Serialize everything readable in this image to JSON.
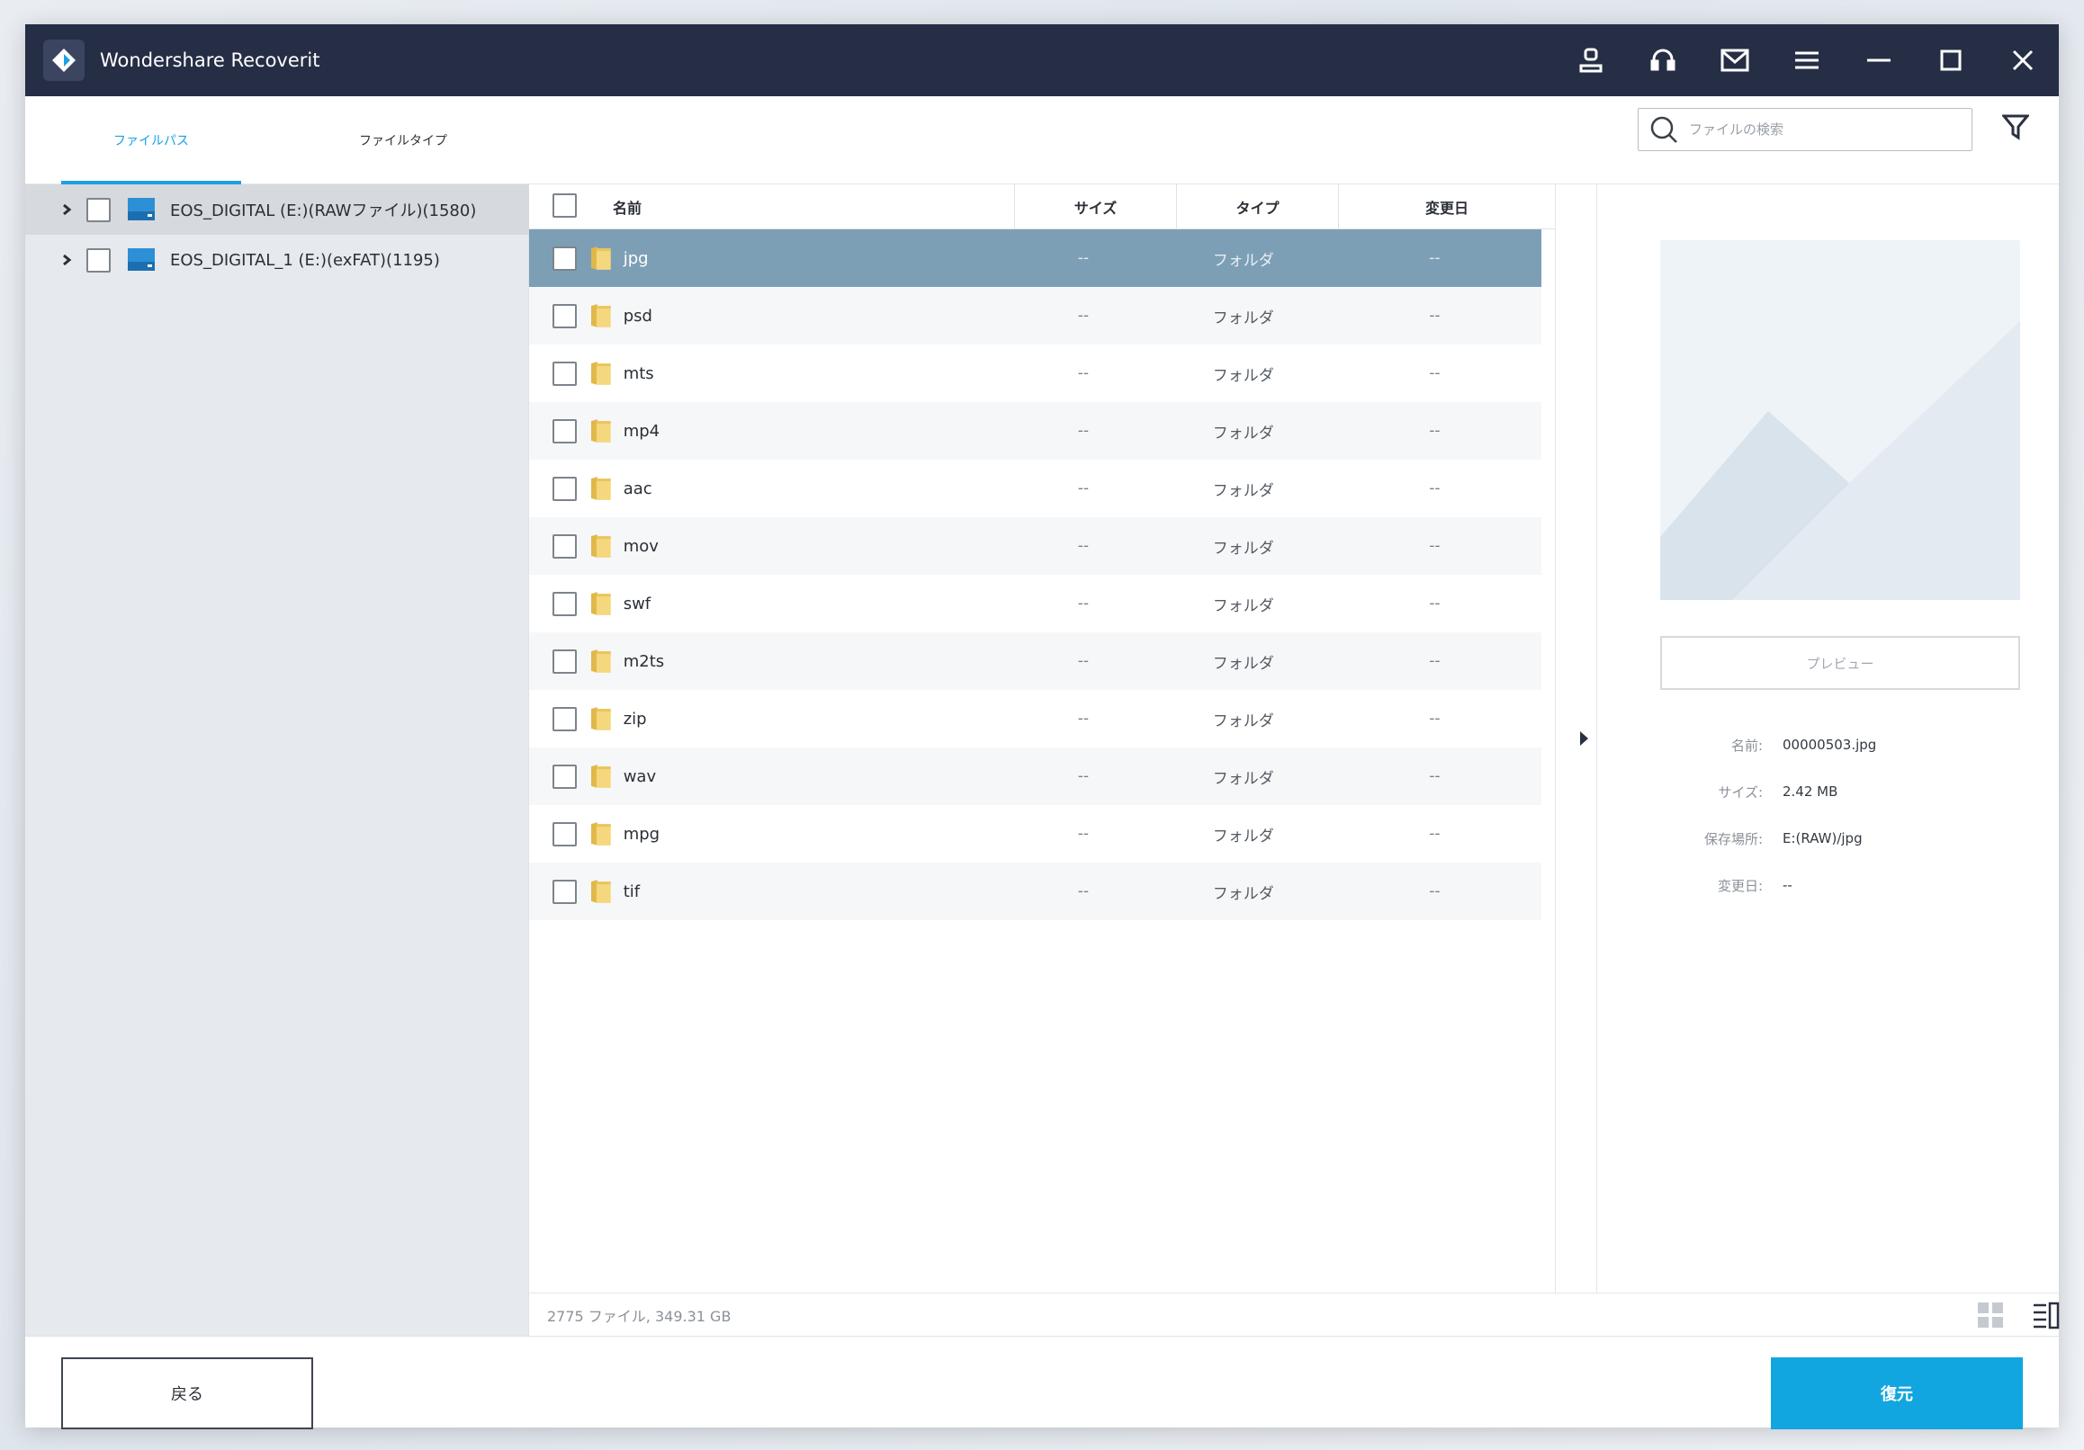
{
  "app": {
    "title": "Wondershare Recoverit"
  },
  "titlebar": {
    "buttons": [
      "account-icon",
      "support-headset-icon",
      "mail-icon",
      "menu-icon",
      "minimize-icon",
      "maximize-icon",
      "close-icon"
    ]
  },
  "left_tabs": [
    {
      "label": "ファイルパス",
      "active": true
    },
    {
      "label": "ファイルタイプ",
      "active": false
    }
  ],
  "tree": [
    {
      "label": "EOS_DIGITAL (E:)(RAWファイル)(1580)",
      "selected": true
    },
    {
      "label": "EOS_DIGITAL_1 (E:)(exFAT)(1195)",
      "selected": false
    }
  ],
  "search": {
    "placeholder": "ファイルの検索",
    "value": ""
  },
  "table": {
    "headers": {
      "name": "名前",
      "size": "サイズ",
      "type": "タイプ",
      "date": "変更日"
    },
    "rows": [
      {
        "name": "jpg",
        "size": "--",
        "type": "フォルダ",
        "date": "--",
        "selected": true
      },
      {
        "name": "psd",
        "size": "--",
        "type": "フォルダ",
        "date": "--"
      },
      {
        "name": "mts",
        "size": "--",
        "type": "フォルダ",
        "date": "--"
      },
      {
        "name": "mp4",
        "size": "--",
        "type": "フォルダ",
        "date": "--"
      },
      {
        "name": "aac",
        "size": "--",
        "type": "フォルダ",
        "date": "--"
      },
      {
        "name": "mov",
        "size": "--",
        "type": "フォルダ",
        "date": "--"
      },
      {
        "name": "swf",
        "size": "--",
        "type": "フォルダ",
        "date": "--"
      },
      {
        "name": "m2ts",
        "size": "--",
        "type": "フォルダ",
        "date": "--"
      },
      {
        "name": "zip",
        "size": "--",
        "type": "フォルダ",
        "date": "--"
      },
      {
        "name": "wav",
        "size": "--",
        "type": "フォルダ",
        "date": "--"
      },
      {
        "name": "mpg",
        "size": "--",
        "type": "フォルダ",
        "date": "--"
      },
      {
        "name": "tif",
        "size": "--",
        "type": "フォルダ",
        "date": "--"
      }
    ]
  },
  "preview": {
    "button_label": "プレビュー",
    "meta": [
      {
        "label": "名前:",
        "value": "00000503.jpg"
      },
      {
        "label": "サイズ:",
        "value": "2.42 MB"
      },
      {
        "label": "保存場所:",
        "value": "E:(RAW)/jpg"
      },
      {
        "label": "変更日:",
        "value": "--"
      }
    ]
  },
  "status": {
    "text": "2775 ファイル, 349.31 GB"
  },
  "footer": {
    "back_label": "戻る",
    "recover_label": "復元"
  },
  "colors": {
    "accent": "#12a6e0",
    "titlebar": "#252e45",
    "selected_row": "#7d9fb6"
  }
}
